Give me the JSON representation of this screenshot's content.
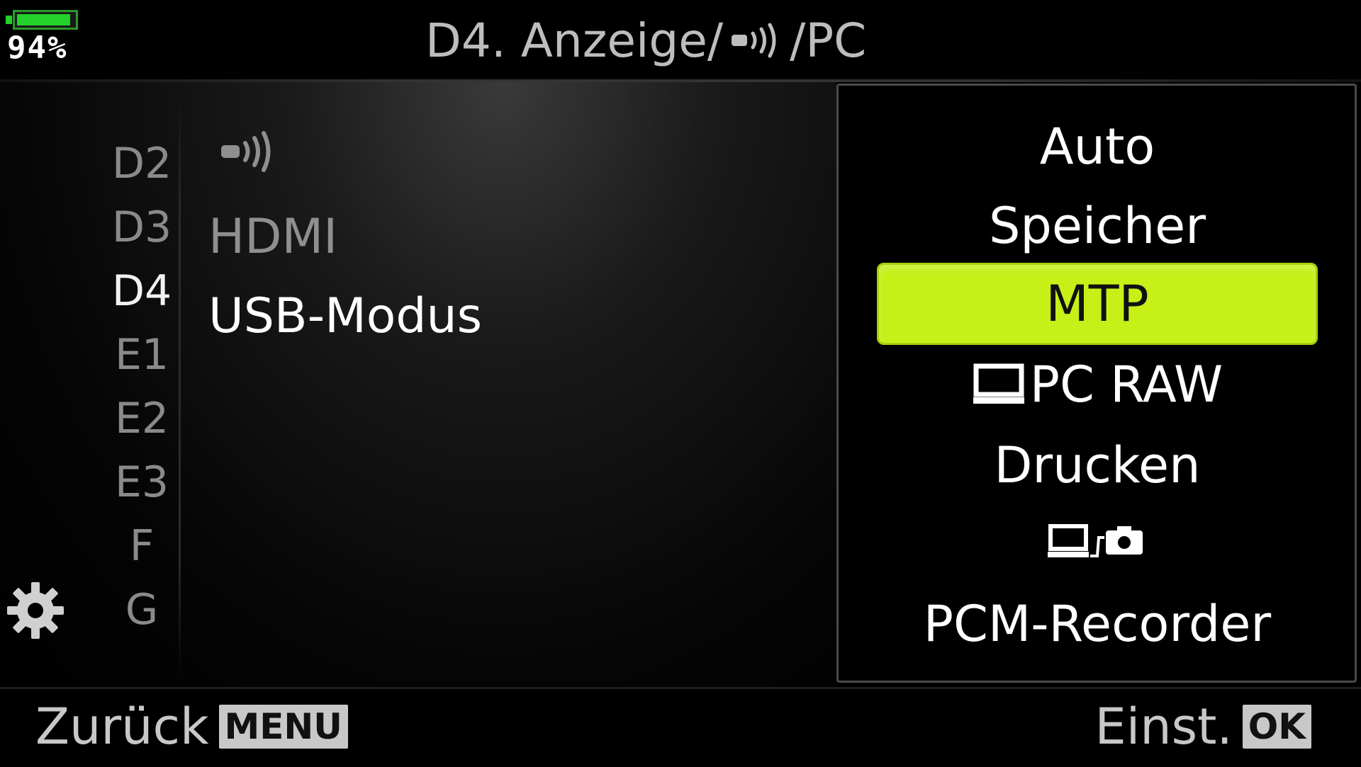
{
  "status": {
    "battery_percent_label": "94%",
    "battery_level": 0.94,
    "battery_color": "#22d22a"
  },
  "header": {
    "title_prefix": "D4. Anzeige/",
    "title_suffix": " /PC",
    "title_icon": "wireless-broadcast-icon"
  },
  "sidebar": {
    "icon": "gear-icon",
    "categories": [
      {
        "label": "D2"
      },
      {
        "label": "D3"
      },
      {
        "label": "D4",
        "active": true
      },
      {
        "label": "E1"
      },
      {
        "label": "E2"
      },
      {
        "label": "E3"
      },
      {
        "label": "F"
      },
      {
        "label": "G"
      }
    ]
  },
  "menu": {
    "items": [
      {
        "icon": "wireless-broadcast-icon",
        "label": ""
      },
      {
        "label": "HDMI"
      },
      {
        "label": "USB-Modus",
        "active": true
      }
    ]
  },
  "options": {
    "items": [
      {
        "label": "Auto"
      },
      {
        "label": "Speicher"
      },
      {
        "label": "MTP",
        "selected": true
      },
      {
        "label": "PC RAW",
        "icon": "computer-icon"
      },
      {
        "label": "Drucken"
      },
      {
        "label": "",
        "icon": "computer-camera-tether-icon"
      },
      {
        "label": "PCM-Recorder"
      }
    ],
    "selected_color": "#c6f018"
  },
  "footer": {
    "back_label": "Zurück",
    "back_key": "MENU",
    "set_label": "Einst.",
    "set_key": "OK"
  }
}
